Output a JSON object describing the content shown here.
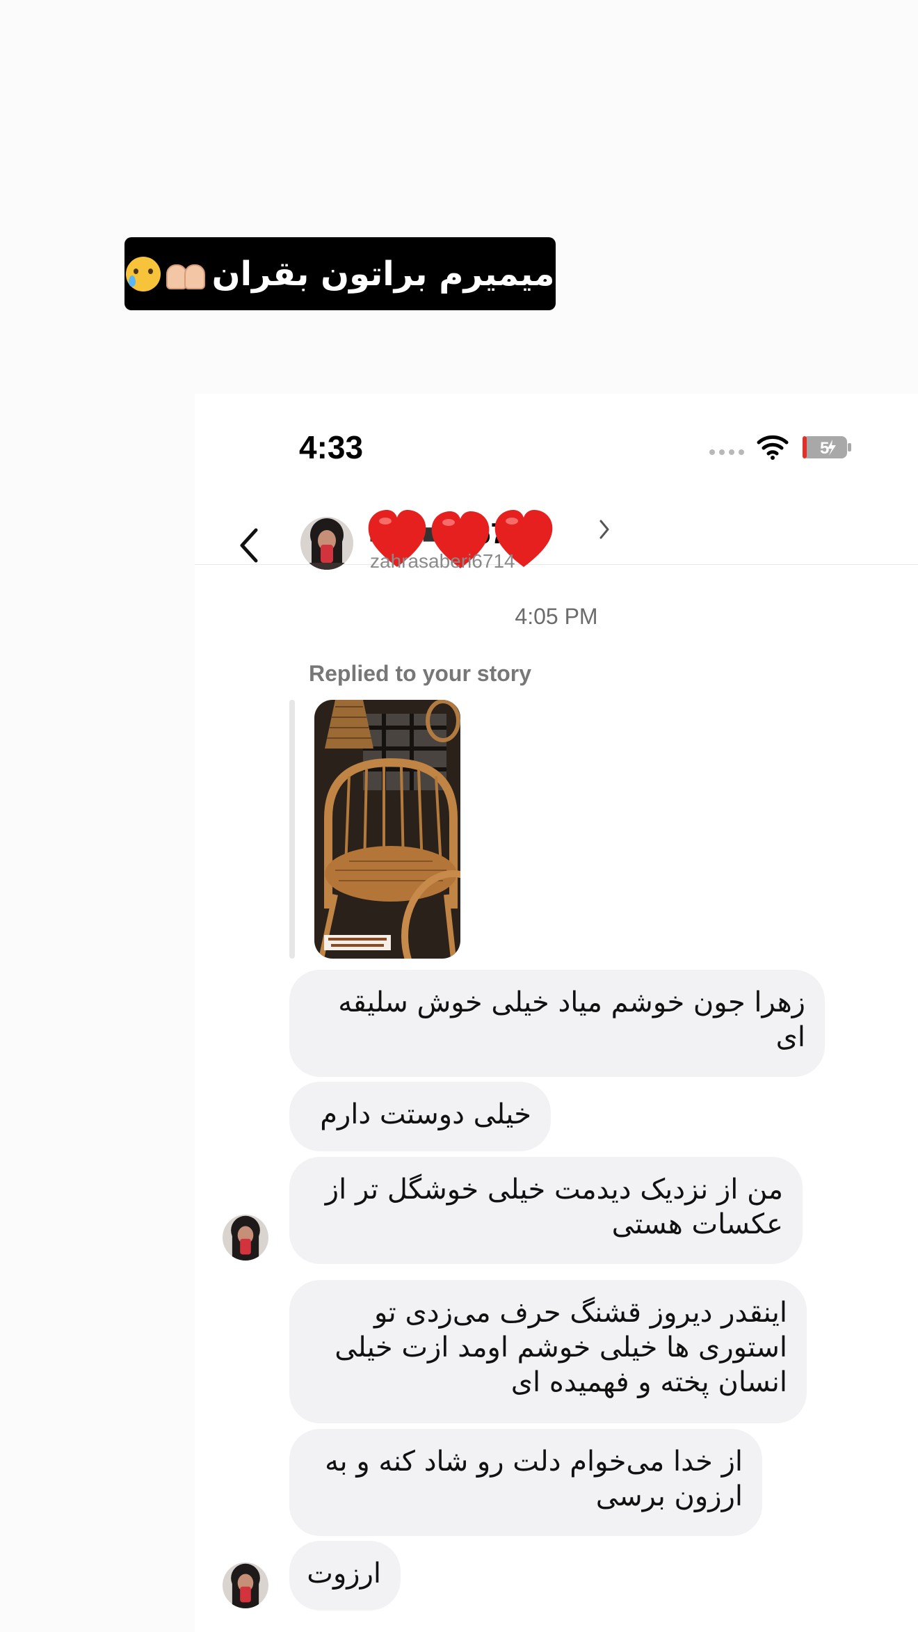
{
  "caption": {
    "text": "میمیرم براتون بقران"
  },
  "status_bar": {
    "time": "4:33",
    "battery": "54"
  },
  "header": {
    "name_visible_end": "67",
    "username": "zahrasaberi6714"
  },
  "conversation": {
    "timestamp": "4:05 PM",
    "story_reply_label": "Replied to your story",
    "story_overlay_text": "",
    "messages": [
      {
        "text": "زهرا جون خوشم میاد خیلی خوش سلیقه ای"
      },
      {
        "text": "خیلی دوستت دارم"
      },
      {
        "text": "من از نزدیک دیدمت خیلی خوشگل تر از عکسات هستی"
      },
      {
        "text": "اینقدر دیروز قشنگ حرف می‌زدی تو استوری ها خیلی خوشم اومد ازت خیلی انسان پخته و فهمیده ای"
      },
      {
        "text": "از خدا می‌خوام دلت رو شاد کنه و به ارزون برسی"
      },
      {
        "text": "ارزوت"
      }
    ]
  },
  "colors": {
    "bubble_bg": "#f2f2f5",
    "heart_red": "#e5201f",
    "caption_bg": "#000000"
  }
}
